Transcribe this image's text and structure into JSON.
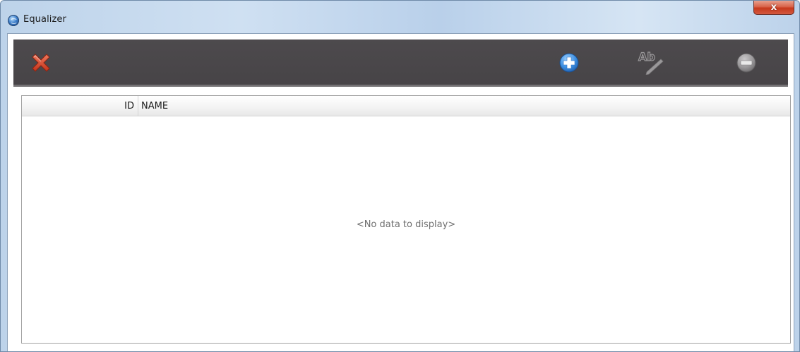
{
  "window": {
    "title": "Equalizer",
    "close_glyph": "x"
  },
  "toolbar": {
    "buttons": [
      {
        "icon": "delete-x-icon",
        "color": "#d9442a"
      },
      {
        "icon": "add-circle-icon",
        "color": "#3a8fe0"
      },
      {
        "icon": "rename-ab-icon",
        "color": "#8f8d8f"
      },
      {
        "icon": "remove-circle-icon",
        "color": "#8f8d8f"
      }
    ]
  },
  "grid": {
    "columns": [
      "ID",
      "NAME"
    ],
    "rows": [],
    "empty_text": "<No data to display>"
  }
}
